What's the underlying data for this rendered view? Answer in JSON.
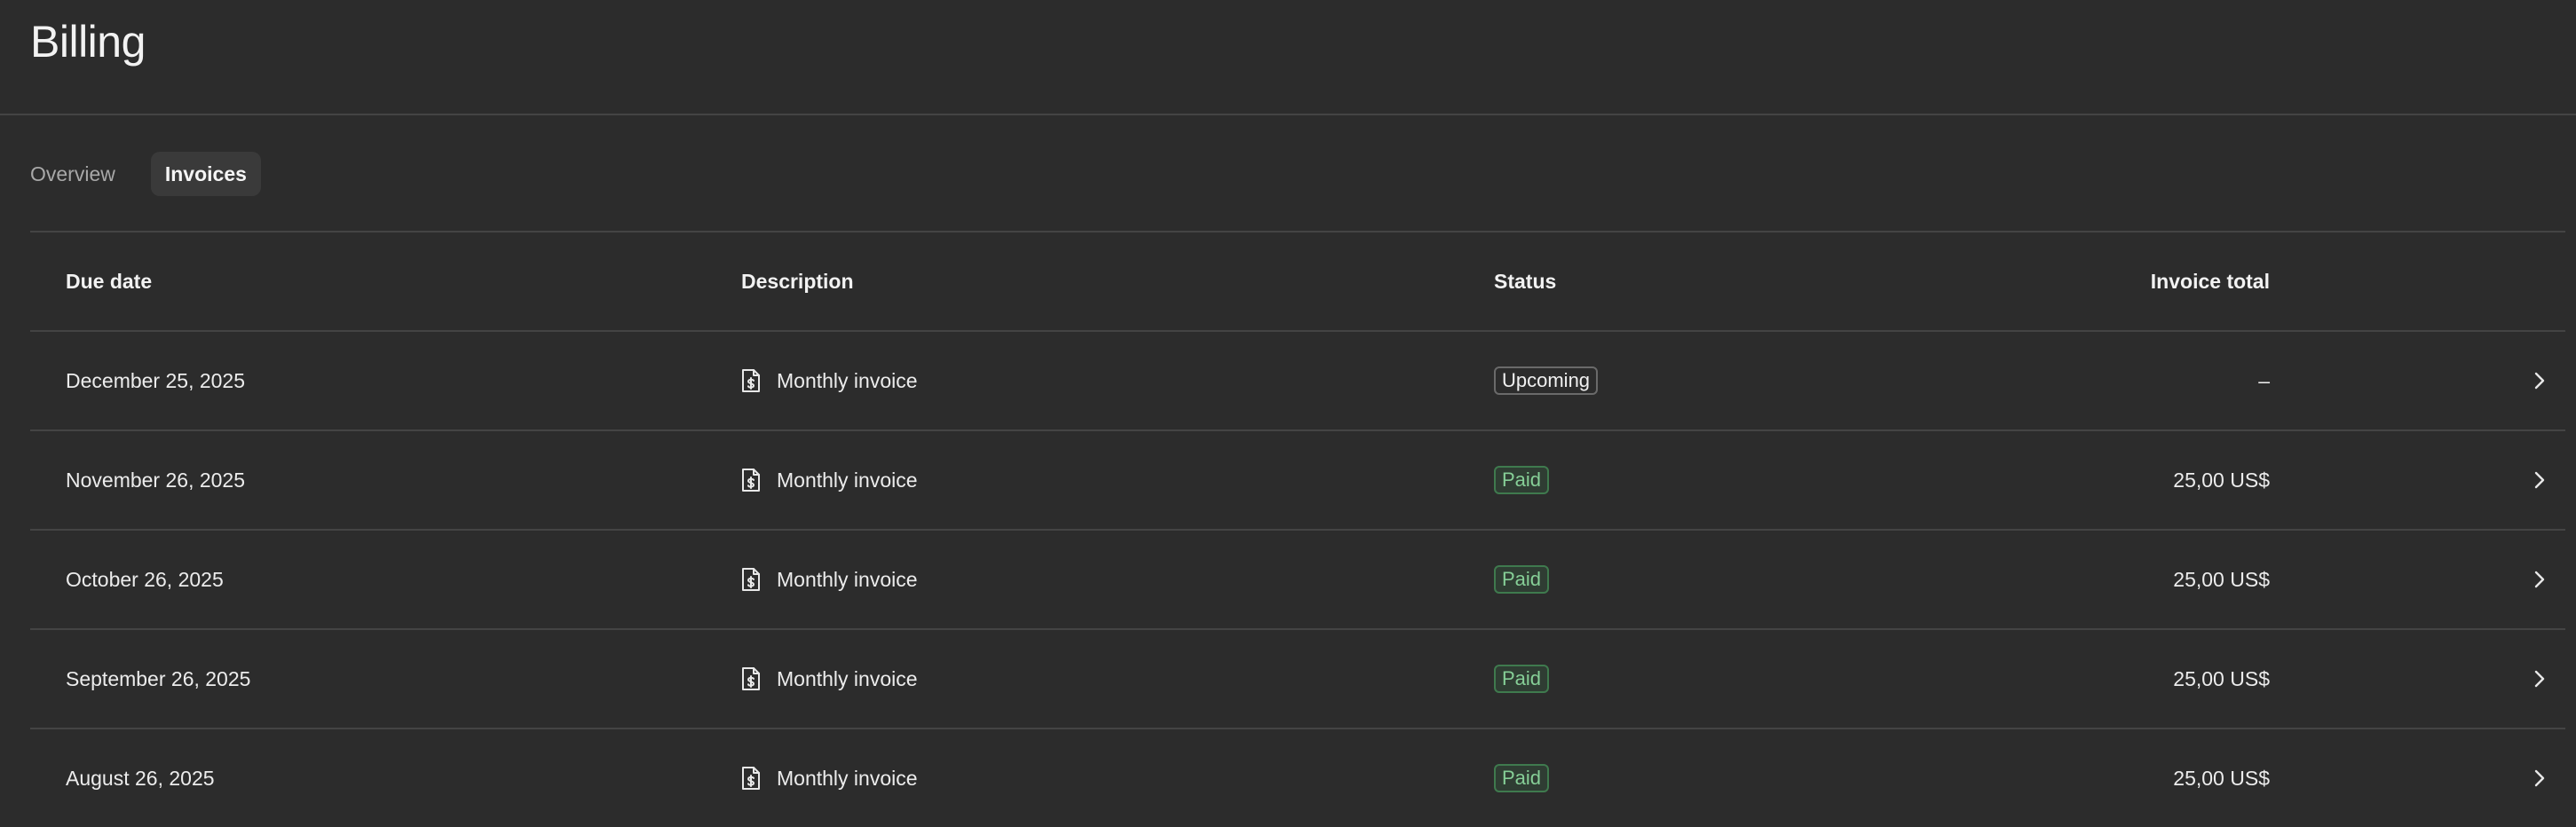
{
  "page": {
    "title": "Billing"
  },
  "tabs": [
    {
      "label": "Overview",
      "active": false
    },
    {
      "label": "Invoices",
      "active": true
    }
  ],
  "table": {
    "columns": {
      "due_date": "Due date",
      "description": "Description",
      "status": "Status",
      "invoice_total": "Invoice total"
    },
    "rows": [
      {
        "due_date": "December 25, 2025",
        "description": "Monthly invoice",
        "status": "Upcoming",
        "invoice_total": "–"
      },
      {
        "due_date": "November 26, 2025",
        "description": "Monthly invoice",
        "status": "Paid",
        "invoice_total": "25,00 US$"
      },
      {
        "due_date": "October 26, 2025",
        "description": "Monthly invoice",
        "status": "Paid",
        "invoice_total": "25,00 US$"
      },
      {
        "due_date": "September 26, 2025",
        "description": "Monthly invoice",
        "status": "Paid",
        "invoice_total": "25,00 US$"
      },
      {
        "due_date": "August 26, 2025",
        "description": "Monthly invoice",
        "status": "Paid",
        "invoice_total": "25,00 US$"
      }
    ]
  },
  "icons": {
    "description": "invoice-document-icon",
    "row_action": "chevron-right-icon"
  },
  "colors": {
    "background": "#2c2c2c",
    "divider": "#444444",
    "paid_text": "#86cf97",
    "paid_border": "#3f7a4e",
    "upcoming_border": "#6a6a6a"
  }
}
